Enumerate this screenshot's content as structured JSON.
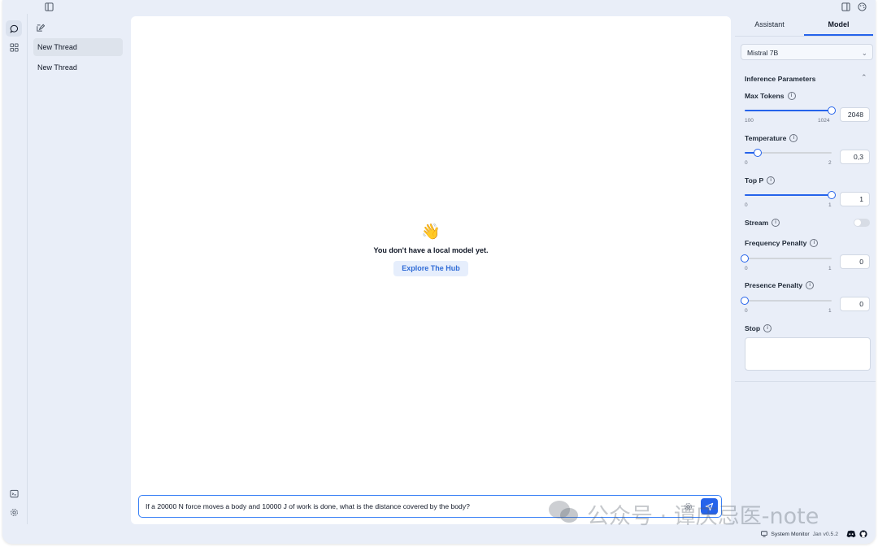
{
  "sidebar": {
    "threads": [
      {
        "label": "New Thread",
        "selected": true
      },
      {
        "label": "New Thread",
        "selected": false
      }
    ]
  },
  "main": {
    "empty_emoji": "👋",
    "empty_message": "You don't have a local model yet.",
    "hub_button": "Explore The Hub",
    "input_value": "If a 20000 N force moves a body and 10000 J of work is done, what is the distance covered by the body?"
  },
  "panel": {
    "tabs": [
      {
        "label": "Assistant",
        "active": false
      },
      {
        "label": "Model",
        "active": true
      }
    ],
    "model_select": "Mistral 7B",
    "section_title": "Inference Parameters",
    "params": {
      "max_tokens": {
        "label": "Max Tokens",
        "min": "100",
        "max": "1024",
        "value": "2048",
        "fraction": 1.0
      },
      "temperature": {
        "label": "Temperature",
        "min": "0",
        "max": "2",
        "value": "0,3",
        "fraction": 0.15
      },
      "top_p": {
        "label": "Top P",
        "min": "0",
        "max": "1",
        "value": "1",
        "fraction": 1.0
      },
      "stream": {
        "label": "Stream",
        "enabled": false
      },
      "frequency_penalty": {
        "label": "Frequency Penalty",
        "min": "0",
        "max": "1",
        "value": "0",
        "fraction": 0.0
      },
      "presence_penalty": {
        "label": "Presence Penalty",
        "min": "0",
        "max": "1",
        "value": "0",
        "fraction": 0.0
      },
      "stop": {
        "label": "Stop",
        "value": ""
      }
    }
  },
  "footer": {
    "system_monitor": "System Monitor",
    "version": "Jan v0.5.2"
  },
  "watermark": {
    "text": "公众号 · 谭庆忌医-note"
  },
  "colors": {
    "accent": "#2563eb",
    "window_bg": "#e9eef8",
    "content_bg": "#ffffff"
  }
}
